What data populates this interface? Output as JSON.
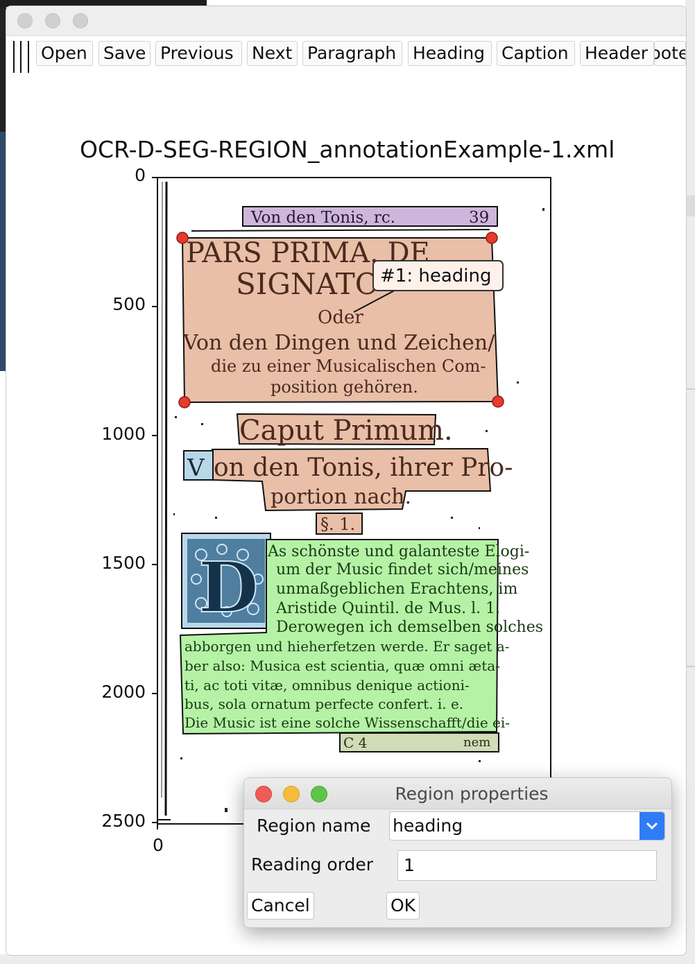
{
  "toolbar": {
    "buttons": [
      "Open",
      "Save",
      "Previous",
      "Next",
      "Paragraph",
      "Heading",
      "Caption",
      "Header",
      "Footer"
    ]
  },
  "plot": {
    "title": "OCR-D-SEG-REGION_annotationExample-1.xml",
    "y_ticks": [
      "0",
      "500",
      "1000",
      "1500",
      "2000",
      "2500"
    ],
    "x_ticks": [
      "0"
    ],
    "annotation": "#1: heading",
    "page_text": {
      "header": "Von den Tonis, rc.",
      "page_number": "39",
      "heading_lines": [
        "PARS PRIMA. DE",
        "SIGNATO",
        "Oder",
        "Von den Dingen und Zeichen/",
        "die zu einer Musicalischen Com-",
        "position gehören."
      ],
      "chapter": "Caput Primum.",
      "chapter_sub": [
        "on den Tonis, ihrer Pro-",
        "portion nach."
      ],
      "dropcap_small": "V",
      "section": "§. 1.",
      "dropcap": "D",
      "body_lines": [
        "As schönste und galanteste Elogi-",
        "um der Music findet sich/meines",
        "unmaßgeblichen Erachtens, im",
        "Aristide Quintil. de Mus. l. 1.",
        "Derowegen ich demselben solches",
        "abborgen und hieherfetzen werde.  Er saget a-",
        "ber also: Musica est scientia, quæ omni æta-",
        "ti, ac toti vitæ, omnibus denique actioni-",
        "bus, sola ornatum perfecte confert. i. e.",
        "Die Music ist eine solche Wissenschafft/die ei-"
      ],
      "signature": "C 4",
      "catchword": "nem"
    },
    "colors": {
      "heading": "#e9bfa8",
      "header": "#cdb6db",
      "paragraph": "#b5f2a6",
      "image": "#b8d8ea",
      "footer": "#d0dcb6",
      "handle": "#e8392a"
    }
  },
  "dialog": {
    "title": "Region properties",
    "region_name_label": "Region name",
    "region_name_value": "heading",
    "reading_order_label": "Reading order",
    "reading_order_value": "1",
    "cancel_label": "Cancel",
    "ok_label": "OK"
  }
}
